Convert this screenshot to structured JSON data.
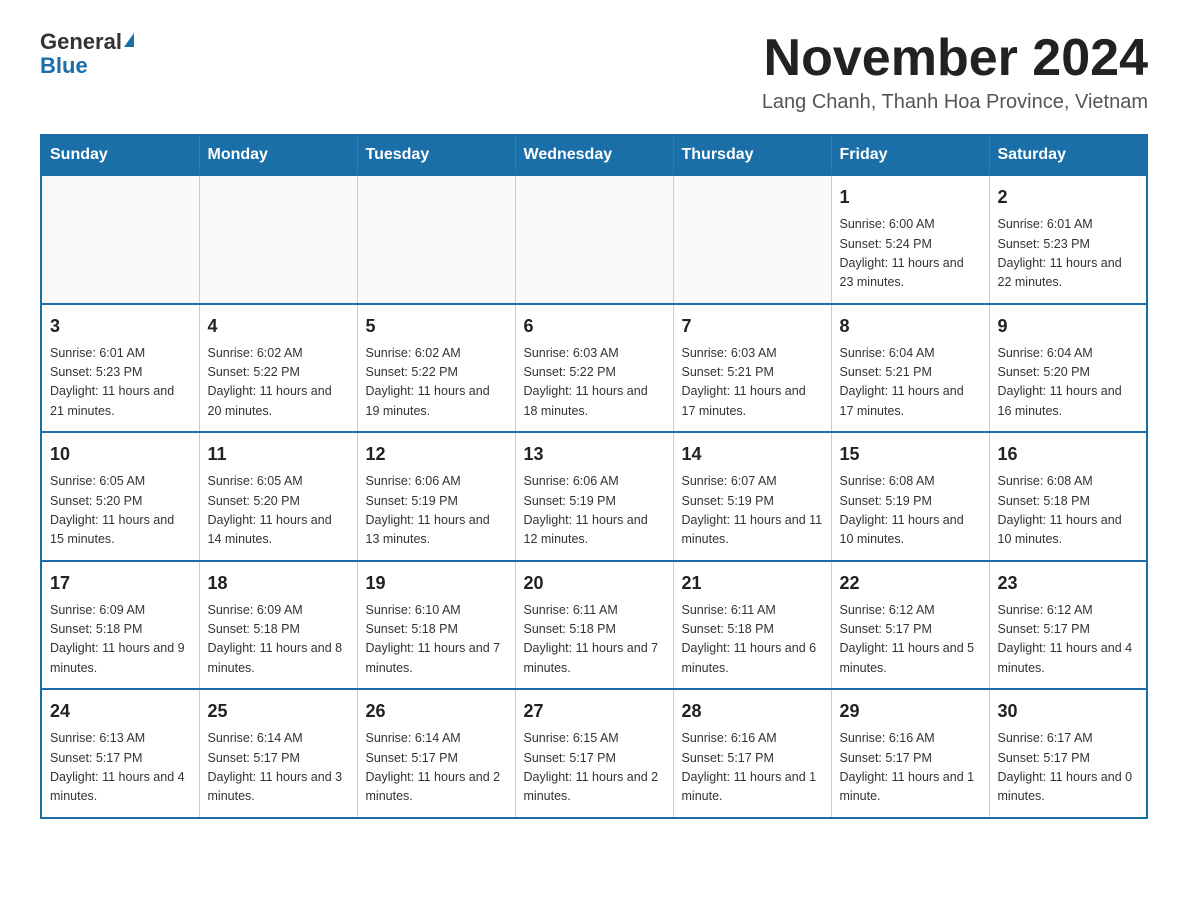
{
  "logo": {
    "general": "General",
    "blue": "Blue"
  },
  "title": "November 2024",
  "location": "Lang Chanh, Thanh Hoa Province, Vietnam",
  "days_of_week": [
    "Sunday",
    "Monday",
    "Tuesday",
    "Wednesday",
    "Thursday",
    "Friday",
    "Saturday"
  ],
  "weeks": [
    [
      {
        "day": "",
        "info": ""
      },
      {
        "day": "",
        "info": ""
      },
      {
        "day": "",
        "info": ""
      },
      {
        "day": "",
        "info": ""
      },
      {
        "day": "",
        "info": ""
      },
      {
        "day": "1",
        "info": "Sunrise: 6:00 AM\nSunset: 5:24 PM\nDaylight: 11 hours and 23 minutes."
      },
      {
        "day": "2",
        "info": "Sunrise: 6:01 AM\nSunset: 5:23 PM\nDaylight: 11 hours and 22 minutes."
      }
    ],
    [
      {
        "day": "3",
        "info": "Sunrise: 6:01 AM\nSunset: 5:23 PM\nDaylight: 11 hours and 21 minutes."
      },
      {
        "day": "4",
        "info": "Sunrise: 6:02 AM\nSunset: 5:22 PM\nDaylight: 11 hours and 20 minutes."
      },
      {
        "day": "5",
        "info": "Sunrise: 6:02 AM\nSunset: 5:22 PM\nDaylight: 11 hours and 19 minutes."
      },
      {
        "day": "6",
        "info": "Sunrise: 6:03 AM\nSunset: 5:22 PM\nDaylight: 11 hours and 18 minutes."
      },
      {
        "day": "7",
        "info": "Sunrise: 6:03 AM\nSunset: 5:21 PM\nDaylight: 11 hours and 17 minutes."
      },
      {
        "day": "8",
        "info": "Sunrise: 6:04 AM\nSunset: 5:21 PM\nDaylight: 11 hours and 17 minutes."
      },
      {
        "day": "9",
        "info": "Sunrise: 6:04 AM\nSunset: 5:20 PM\nDaylight: 11 hours and 16 minutes."
      }
    ],
    [
      {
        "day": "10",
        "info": "Sunrise: 6:05 AM\nSunset: 5:20 PM\nDaylight: 11 hours and 15 minutes."
      },
      {
        "day": "11",
        "info": "Sunrise: 6:05 AM\nSunset: 5:20 PM\nDaylight: 11 hours and 14 minutes."
      },
      {
        "day": "12",
        "info": "Sunrise: 6:06 AM\nSunset: 5:19 PM\nDaylight: 11 hours and 13 minutes."
      },
      {
        "day": "13",
        "info": "Sunrise: 6:06 AM\nSunset: 5:19 PM\nDaylight: 11 hours and 12 minutes."
      },
      {
        "day": "14",
        "info": "Sunrise: 6:07 AM\nSunset: 5:19 PM\nDaylight: 11 hours and 11 minutes."
      },
      {
        "day": "15",
        "info": "Sunrise: 6:08 AM\nSunset: 5:19 PM\nDaylight: 11 hours and 10 minutes."
      },
      {
        "day": "16",
        "info": "Sunrise: 6:08 AM\nSunset: 5:18 PM\nDaylight: 11 hours and 10 minutes."
      }
    ],
    [
      {
        "day": "17",
        "info": "Sunrise: 6:09 AM\nSunset: 5:18 PM\nDaylight: 11 hours and 9 minutes."
      },
      {
        "day": "18",
        "info": "Sunrise: 6:09 AM\nSunset: 5:18 PM\nDaylight: 11 hours and 8 minutes."
      },
      {
        "day": "19",
        "info": "Sunrise: 6:10 AM\nSunset: 5:18 PM\nDaylight: 11 hours and 7 minutes."
      },
      {
        "day": "20",
        "info": "Sunrise: 6:11 AM\nSunset: 5:18 PM\nDaylight: 11 hours and 7 minutes."
      },
      {
        "day": "21",
        "info": "Sunrise: 6:11 AM\nSunset: 5:18 PM\nDaylight: 11 hours and 6 minutes."
      },
      {
        "day": "22",
        "info": "Sunrise: 6:12 AM\nSunset: 5:17 PM\nDaylight: 11 hours and 5 minutes."
      },
      {
        "day": "23",
        "info": "Sunrise: 6:12 AM\nSunset: 5:17 PM\nDaylight: 11 hours and 4 minutes."
      }
    ],
    [
      {
        "day": "24",
        "info": "Sunrise: 6:13 AM\nSunset: 5:17 PM\nDaylight: 11 hours and 4 minutes."
      },
      {
        "day": "25",
        "info": "Sunrise: 6:14 AM\nSunset: 5:17 PM\nDaylight: 11 hours and 3 minutes."
      },
      {
        "day": "26",
        "info": "Sunrise: 6:14 AM\nSunset: 5:17 PM\nDaylight: 11 hours and 2 minutes."
      },
      {
        "day": "27",
        "info": "Sunrise: 6:15 AM\nSunset: 5:17 PM\nDaylight: 11 hours and 2 minutes."
      },
      {
        "day": "28",
        "info": "Sunrise: 6:16 AM\nSunset: 5:17 PM\nDaylight: 11 hours and 1 minute."
      },
      {
        "day": "29",
        "info": "Sunrise: 6:16 AM\nSunset: 5:17 PM\nDaylight: 11 hours and 1 minute."
      },
      {
        "day": "30",
        "info": "Sunrise: 6:17 AM\nSunset: 5:17 PM\nDaylight: 11 hours and 0 minutes."
      }
    ]
  ]
}
